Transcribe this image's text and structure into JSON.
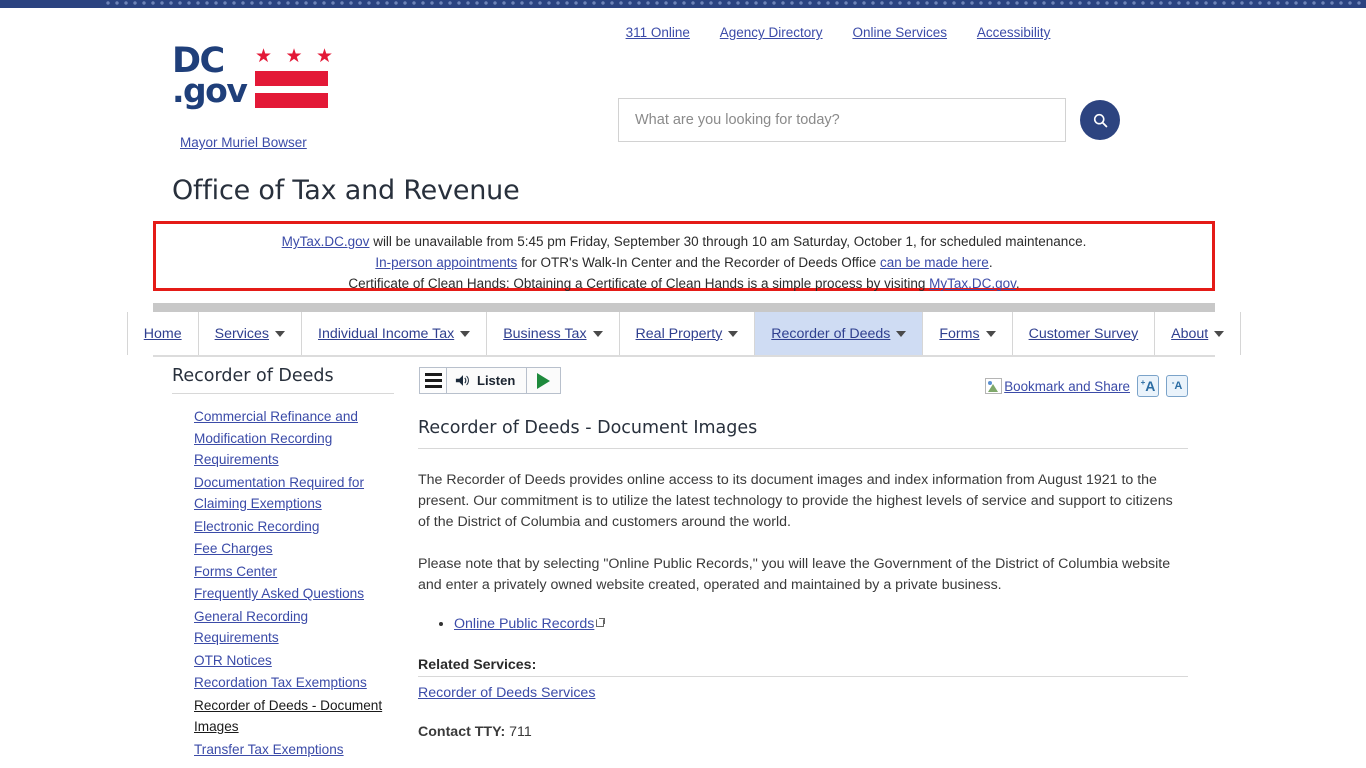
{
  "top_band": {
    "color": "#2b4380"
  },
  "utility_nav": {
    "links": [
      {
        "label": "311 Online"
      },
      {
        "label": "Agency Directory"
      },
      {
        "label": "Online Services"
      },
      {
        "label": "Accessibility"
      }
    ]
  },
  "logo": {
    "dc": "DC",
    "gov": ".gov",
    "mayor_link": "Mayor Muriel Bowser",
    "flag_star": "★",
    "colors": {
      "navy": "#1f3f7a",
      "red": "#e31937"
    }
  },
  "search": {
    "placeholder": "What are you looking for today?",
    "value": "",
    "icon": "search-icon",
    "button_color": "#2d4480"
  },
  "agency": {
    "title": "Office of Tax and Revenue"
  },
  "alert": {
    "border_color": "#e41b17",
    "line1": {
      "link1": "MyTax.DC.gov",
      "text": " will be unavailable from 5:45 pm Friday, September 30 through 10 am Saturday, October 1, for scheduled maintenance."
    },
    "line2": {
      "link1": "In-person appointments",
      "mid": " for OTR's Walk-In Center and the Recorder of Deeds Office ",
      "link2": "can be made here",
      "tail": "."
    },
    "line3": {
      "text": "Certificate of Clean Hands: Obtaining a Certificate of Clean Hands is a simple process by visiting ",
      "link1": "MyTax.DC.gov",
      "tail": "."
    }
  },
  "main_nav": {
    "items": [
      {
        "label": "Home",
        "caret": false,
        "active": false
      },
      {
        "label": "Services",
        "caret": true,
        "active": false
      },
      {
        "label": "Individual Income Tax",
        "caret": true,
        "active": false
      },
      {
        "label": "Business Tax",
        "caret": true,
        "active": false
      },
      {
        "label": "Real Property",
        "caret": true,
        "active": false
      },
      {
        "label": "Recorder of Deeds",
        "caret": true,
        "active": true
      },
      {
        "label": "Forms",
        "caret": true,
        "active": false
      },
      {
        "label": "Customer Survey",
        "caret": false,
        "active": false
      },
      {
        "label": "About",
        "caret": true,
        "active": false
      }
    ],
    "active_bg": "#cfdcf3"
  },
  "sidebar": {
    "title": "Recorder of Deeds",
    "items": [
      {
        "label": "Commercial Refinance and Modification Recording Requirements",
        "current": false
      },
      {
        "label": "Documentation Required for Claiming Exemptions",
        "current": false
      },
      {
        "label": "Electronic Recording",
        "current": false
      },
      {
        "label": "Fee Charges",
        "current": false
      },
      {
        "label": "Forms Center",
        "current": false
      },
      {
        "label": "Frequently Asked Questions",
        "current": false
      },
      {
        "label": "General Recording Requirements",
        "current": false
      },
      {
        "label": "OTR Notices",
        "current": false
      },
      {
        "label": "Recordation Tax Exemptions",
        "current": false
      },
      {
        "label": "Recorder of Deeds - Document Images",
        "current": true
      },
      {
        "label": "Transfer Tax Exemptions",
        "current": false
      }
    ]
  },
  "listen_widget": {
    "menu_icon": "hamburger-menu-icon",
    "speaker_icon": "speaker-icon",
    "label": "Listen",
    "play_icon": "play-icon"
  },
  "page_tools": {
    "bookmark_label": "Bookmark and Share",
    "bookmark_icon": "broken-image-icon",
    "increase_font": {
      "sup": "+",
      "letter": "A"
    },
    "decrease_font": {
      "sup": "-",
      "letter": "A"
    }
  },
  "content": {
    "heading": "Recorder of Deeds - Document Images",
    "paragraph1": "The Recorder of Deeds provides online access to its document images and index information from August 1921 to the present. Our commitment is to utilize the latest technology to provide the highest levels of service and support to citizens of the District of Columbia and customers around the world.",
    "paragraph2": "Please note that by selecting \"Online Public Records,\" you will leave the Government of the District of Columbia website and enter a privately owned website created, operated and maintained by a private business.",
    "bullets": [
      {
        "label": "Online Public Records",
        "external": true
      }
    ],
    "related_services_heading": "Related Services:",
    "related_services_link": "Recorder of Deeds Services",
    "contact_tty_label": "Contact TTY:",
    "contact_tty_value": "711"
  }
}
